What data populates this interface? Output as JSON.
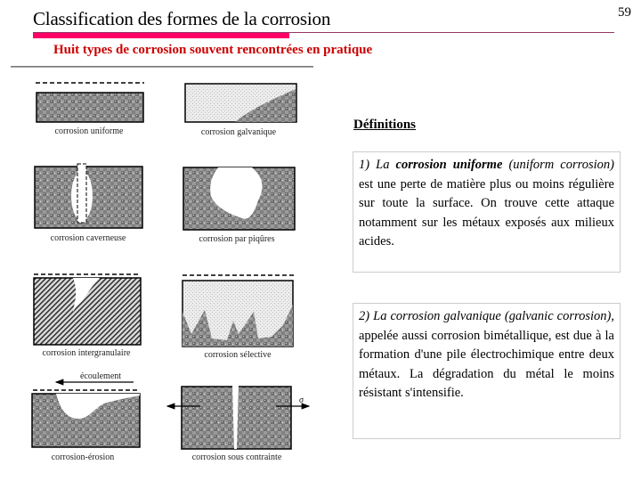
{
  "header": {
    "title": "Classification des formes de la corrosion",
    "page_number": "59",
    "subtitle": "Huit types de corrosion souvent rencontrées en pratique",
    "accent_color": "#ff0066",
    "subtitle_color": "#cc0000"
  },
  "figure": {
    "captions": {
      "uniforme": "corrosion uniforme",
      "galvanique": "corrosion galvanique",
      "caverneuse": "corrosion caverneuse",
      "piqures": "corrosion par piqûres",
      "intergranulaire": "corrosion intergranulaire",
      "selective": "corrosion sélective",
      "erosion": "corrosion-érosion",
      "contrainte": "corrosion sous contrainte"
    },
    "flow_label": "écoulement",
    "stress_symbol": "σ"
  },
  "definitions": {
    "title": "Définitions",
    "def1": {
      "prefix": "1) La ",
      "term": "corrosion uniforme",
      "english": " (uniform corrosion)",
      "text": " est une perte de matière plus ou moins régulière sur toute la surface. On trouve cette attaque notamment sur les métaux exposés aux milieux acides."
    },
    "def2": {
      "prefix": "2) La corrosion galvanique (galvanic corrosion),",
      "text": " appelée aussi corrosion bimétallique, est due à la formation d'une pile électrochimique entre deux métaux. La dégradation du métal le moins résistant s'intensifie."
    }
  }
}
